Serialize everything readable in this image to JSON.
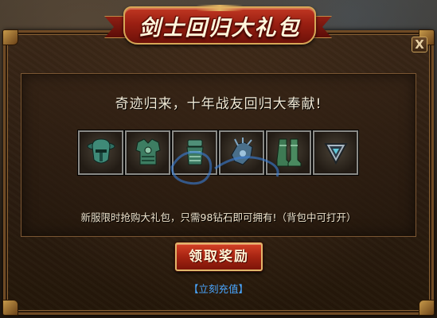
{
  "title": "剑士回归大礼包",
  "close_label": "X",
  "subtitle": "奇迹归来，十年战友回归大奉献!",
  "items": [
    {
      "icon": "helmet-icon"
    },
    {
      "icon": "chest-armor-icon"
    },
    {
      "icon": "gauntlet-icon"
    },
    {
      "icon": "glove-icon"
    },
    {
      "icon": "boots-icon"
    },
    {
      "icon": "pendant-icon"
    }
  ],
  "description": "新服限时抢购大礼包，只需98钻石即可拥有!（背包中可打开）",
  "claim_button": "领取奖励",
  "recharge_link": "【立刻充值】",
  "colors": {
    "ribbon": "#9a1f12",
    "button": "#a62412",
    "link": "#4aa6ff",
    "frame": "#6f4a24"
  }
}
